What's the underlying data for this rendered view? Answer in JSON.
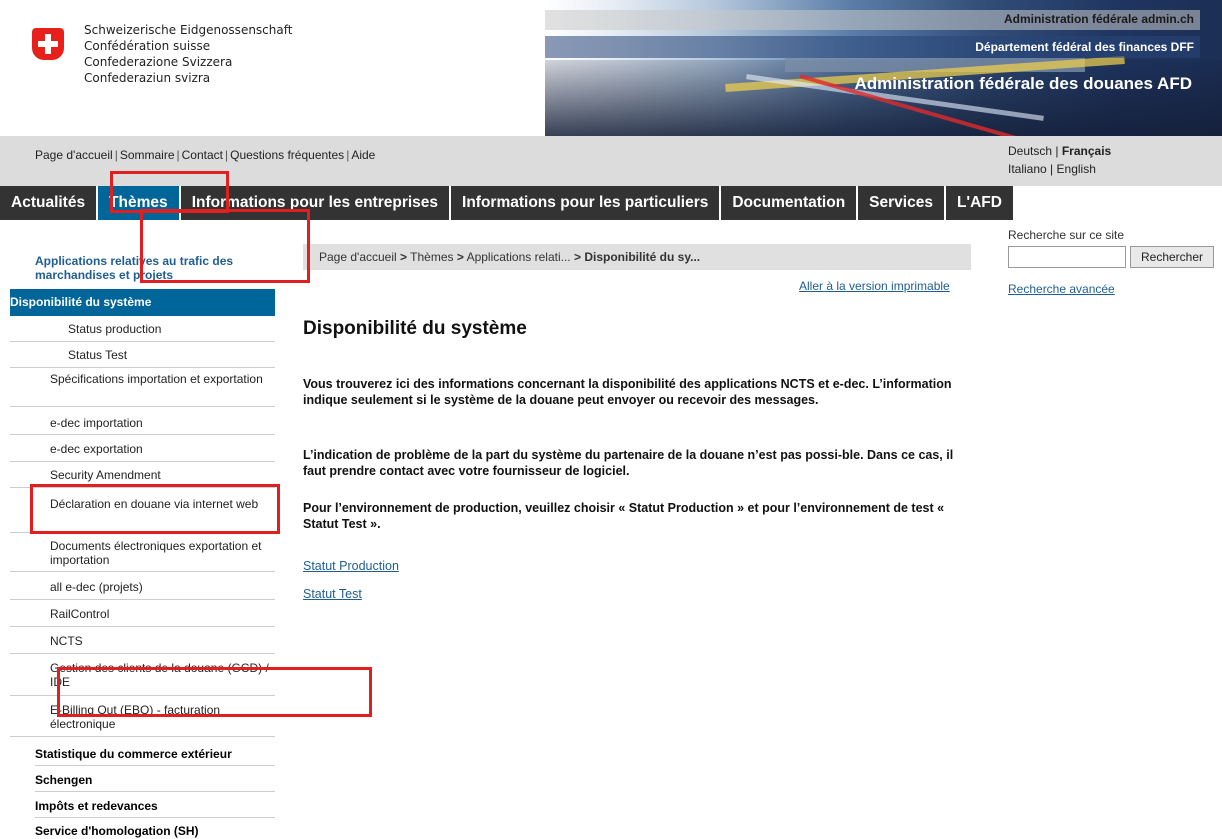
{
  "header": {
    "confederation": [
      "Schweizerische Eidgenossenschaft",
      "Confédération suisse",
      "Confederazione Svizzera",
      "Confederaziun svizra"
    ],
    "admin_bar": "Administration fédérale admin.ch",
    "dept_bar": "Département fédéral des finances DFF",
    "office_title": "Administration fédérale des douanes AFD"
  },
  "service_links": [
    "Page d'accueil",
    "Sommaire",
    "Contact",
    "Questions fréquentes",
    "Aide"
  ],
  "service_sep": "|",
  "languages": {
    "deutsch": "Deutsch",
    "francais": "Français",
    "italiano": "Italiano",
    "english": "English",
    "sep": "|"
  },
  "main_nav": [
    "Actualités",
    "Thèmes",
    "Informations pour les entreprises",
    "Informations pour les particuliers",
    "Documentation",
    "Services",
    "L'AFD"
  ],
  "left_nav": {
    "section_title": "Applications relatives au trafic des marchandises et projets",
    "active": "Disponibilité du système",
    "sub_items": [
      "Status production",
      "Status Test"
    ],
    "items": [
      "Spécifications importation et exportation",
      "e-dec importation",
      "e-dec exportation",
      "Security Amendment",
      "Déclaration en douane via internet web",
      "Documents électroniques exportation et importation",
      "all e-dec (projets)",
      "RailControl",
      "NCTS",
      "Gestion des clients de la douane (GCD) / IDE",
      "E-Billing Out (EBO) - facturation électronique"
    ],
    "top_items": [
      "Statistique du commerce extérieur",
      "Schengen",
      "Impôts et redevances",
      "Service d'homologation (SH)"
    ]
  },
  "breadcrumb": {
    "home": "Page d'accueil",
    "themes": "Thèmes",
    "apps": "Applications relati...",
    "current": "Disponibilité du sy...",
    "sep": ">"
  },
  "print_link": "Aller à la version imprimable",
  "content": {
    "title": "Disponibilité du système",
    "p1": "Vous trouverez ici des informations concernant la disponibilité des applications NCTS et e-dec. L’information indique seulement si le système de la douane peut envoyer ou recevoir des messages.",
    "p2": "L’indication de problème de la part du système du partenaire de la douane n’est pas possi-ble. Dans ce cas, il faut prendre contact avec votre fournisseur de logiciel.",
    "p3": "Pour l’environnement de production, veuillez choisir « Statut Production » et pour l’environnement de test « Statut Test ».",
    "link_production": "Statut Production",
    "link_test": "Statut Test"
  },
  "search": {
    "label": "Recherche sur ce site",
    "value": "",
    "button": "Rechercher",
    "advanced": "Recherche avancée"
  },
  "colors": {
    "nav_dark": "#333333",
    "nav_active": "#006699",
    "link": "#1f5e92",
    "annotation": "#e02020"
  }
}
